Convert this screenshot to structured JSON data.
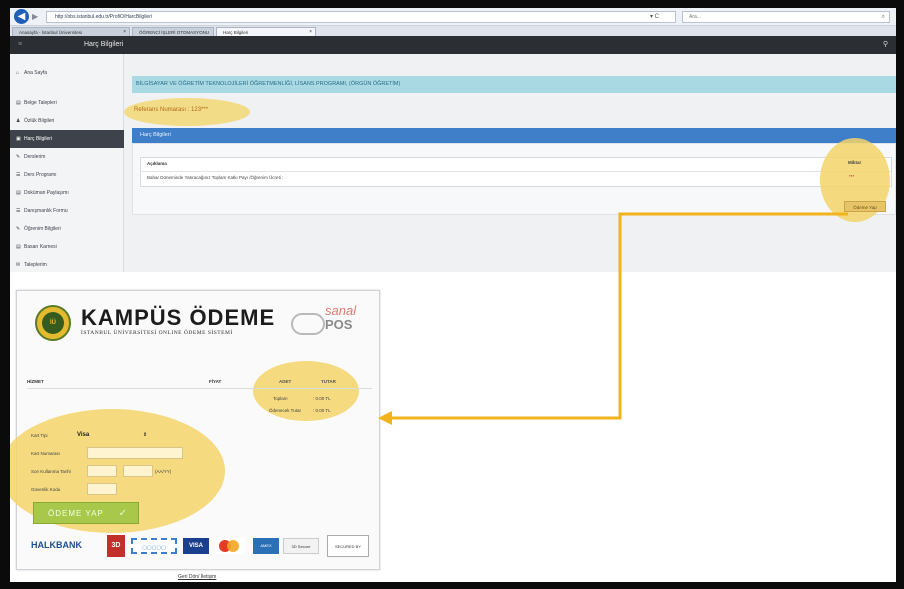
{
  "browser": {
    "url": "http://obs.istanbul.edu.tr/ProfiO/HarcBilgileri",
    "search_placeholder": "Ara...",
    "refresh_label": "▾ C",
    "tabs": [
      {
        "label": "Anasayfa - İstanbul Üniversitesi"
      },
      {
        "label": "ÖĞRENCİ İŞLERİ OTOMASYONU"
      },
      {
        "label": "Harç Bilgileri"
      }
    ]
  },
  "header": {
    "title": "Harç Bilgileri"
  },
  "sidebar": {
    "items": [
      {
        "icon": "⌂",
        "label": "Ana Sayfa"
      },
      {
        "icon": "▤",
        "label": "Belge Talepleri"
      },
      {
        "icon": "♟",
        "label": "Özlük Bilgileri"
      },
      {
        "icon": "▣",
        "label": "Harç Bilgileri"
      },
      {
        "icon": "✎",
        "label": "Derslerim"
      },
      {
        "icon": "☰",
        "label": "Ders Programı"
      },
      {
        "icon": "▤",
        "label": "Doküman Paylaşımı"
      },
      {
        "icon": "☰",
        "label": "Danışmanlık Formu"
      },
      {
        "icon": "✎",
        "label": "Öğrenim Bilgileri"
      },
      {
        "icon": "▤",
        "label": "Basarı Karnesi"
      },
      {
        "icon": "✉",
        "label": "Taleplerim"
      }
    ]
  },
  "main": {
    "program_title": "BİLGİSAYAR VE ÖĞRETİM TEKNOLOJİLERİ ÖĞRETMENLİĞİ, LİSANS PROGRAMI, (ÖRGÜN ÖĞRETİM)",
    "reference_label": "Referans Numarası : 123***",
    "fees_header": "Harç Bilgileri",
    "table": {
      "col_description": "Açıklama",
      "col_amount": "Miktar",
      "row_description": "Bahar Döneminde Yatıracağınız Toplam Katkı Payı /Öğrenim Ücreti :",
      "row_amount": "***"
    },
    "pay_button_label": "Ödeme Yap"
  },
  "payment": {
    "brand_title": "KAMPÜS ÖDEME",
    "brand_subtitle": "İSTANBUL ÜNİVERSİTESİ ONLINE ÖDEME SİSTEMİ",
    "seal_text": "İÜ",
    "sanal_text": "sanal",
    "pos_text": "POS",
    "columns": {
      "service": "HİZMET",
      "price": "FİYAT",
      "quantity": "ADET",
      "total": "TUTAR"
    },
    "totals": {
      "total_label": "Toplam",
      "total_value": ": 0.00 TL",
      "payable_label": "Ödenecek Tutar",
      "payable_value": ": 0.00 TL"
    },
    "card_type_label": "Kart Tipi",
    "card_type_value": "Visa",
    "card_number_label": "Kart Numarası",
    "expiry_label": "Son Kullanma Tarihi",
    "expiry_hint": "(AA/YY)",
    "cvv_label": "Güvenlik Kodu",
    "pay_button_label": "ÖDEME YAP",
    "logos": {
      "halkbank": "HALKBANK",
      "ssl_badge": "3D",
      "lock": "▢▢▢▢▢",
      "visa": "VISA",
      "amex": "AMEX",
      "secure": "3D Secure",
      "norton": "SECURED BY"
    },
    "back_link": "Geri Dön/ İletişim"
  },
  "colors": {
    "highlight": "#f3d36a",
    "arrow": "#f2b41c",
    "program_bar": "#a9d9e3",
    "fees_header": "#3f7fc9",
    "sidebar_active": "#3e434b"
  }
}
